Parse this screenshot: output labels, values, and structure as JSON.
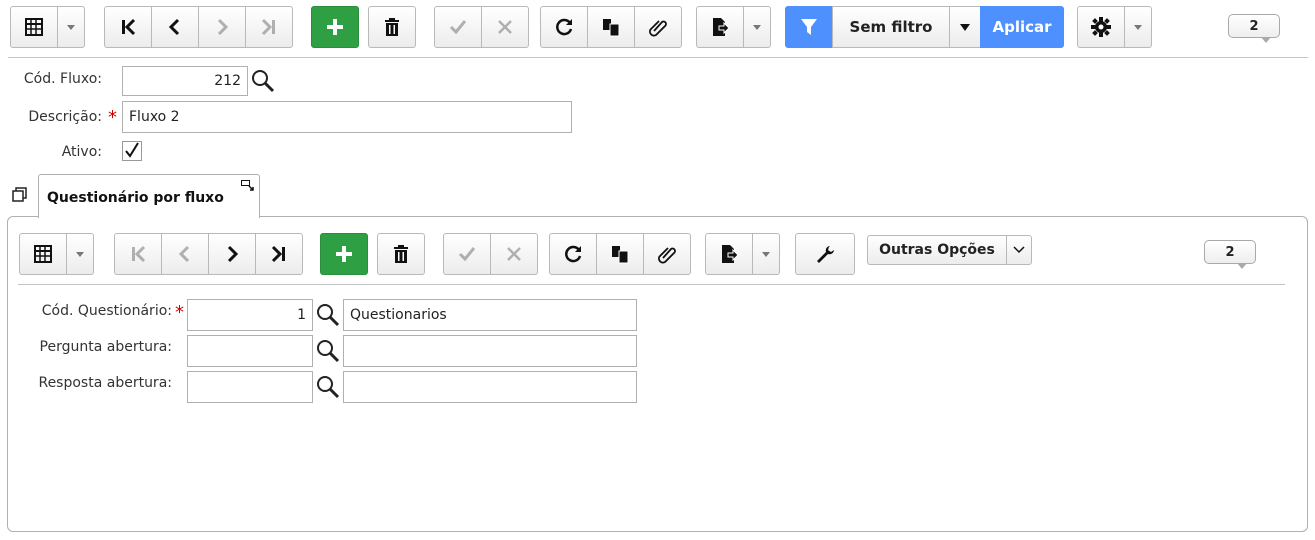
{
  "toolbar": {
    "filter_value": "Sem filtro",
    "apply_label": "Aplicar",
    "record_count": "2"
  },
  "form": {
    "cod_fluxo_label": "Cód. Fluxo:",
    "cod_fluxo_value": "212",
    "descricao_label": "Descrição:",
    "descricao_value": "Fluxo 2",
    "ativo_label": "Ativo:",
    "ativo_checked": true,
    "required_mark": "*"
  },
  "tab": {
    "label": "Questionário por fluxo"
  },
  "sub_toolbar": {
    "other_options_label": "Outras Opções",
    "record_count": "2"
  },
  "sub_form": {
    "cod_questionario_label": "Cód. Questionário:",
    "cod_questionario_value": "1",
    "cod_questionario_desc": "Questionarios",
    "pergunta_label": "Pergunta abertura:",
    "pergunta_value": "",
    "pergunta_desc": "",
    "resposta_label": "Resposta abertura:",
    "resposta_value": "",
    "resposta_desc": ""
  },
  "colors": {
    "primary_blue": "#4d90fe",
    "add_green": "#2ea043",
    "required_red": "#cc0000"
  }
}
